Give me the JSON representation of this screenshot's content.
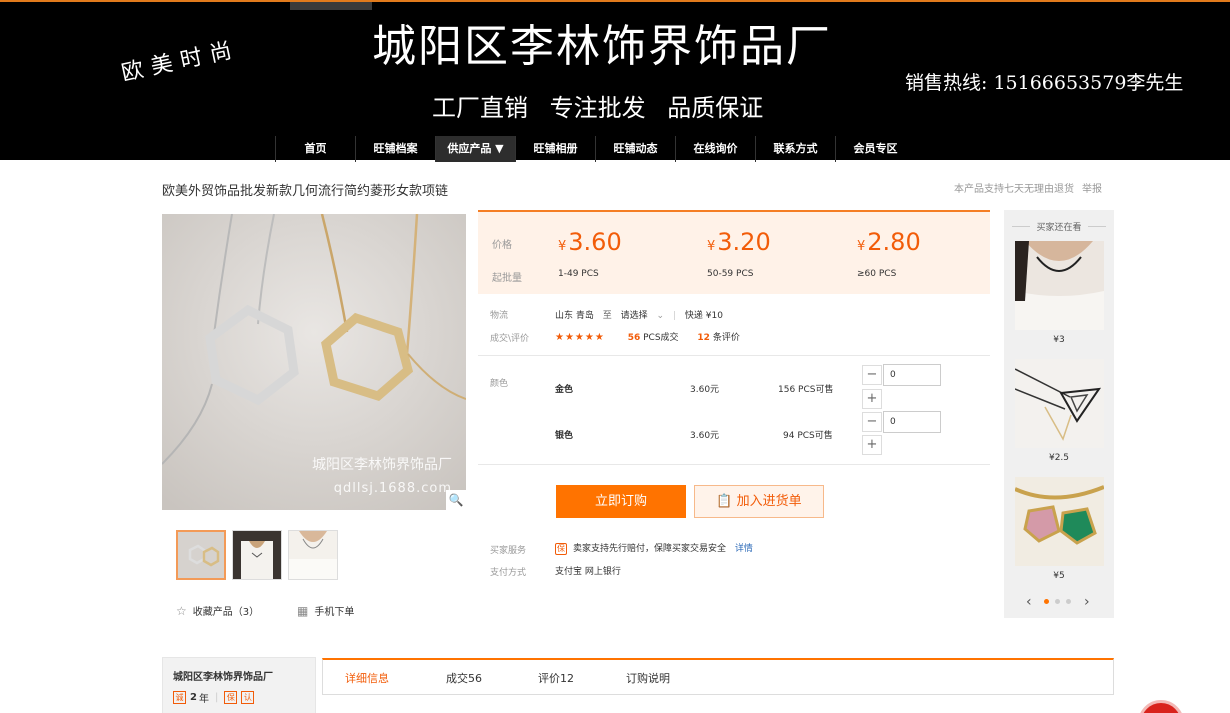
{
  "banner": {
    "slogan": "欧美时尚",
    "shop_name": "城阳区李林饰界饰品厂",
    "subline": "工厂直销  专注批发  品质保证",
    "hotline": "销售热线: 15166653579李先生"
  },
  "nav": {
    "items": [
      "首页",
      "旺铺档案",
      "供应产品 ▼",
      "旺铺相册",
      "旺铺动态",
      "在线询价",
      "联系方式",
      "会员专区"
    ],
    "active_index": 2
  },
  "product": {
    "title": "欧美外贸饰品批发新款几何流行简约菱形女款项链",
    "return_note": "本产品支持七天无理由退货",
    "report": "举报",
    "watermark_line1": "城阳区李林饰界饰品厂",
    "watermark_line2": "qdllsj.1688.com",
    "zoom_icon": "magnifier-icon",
    "favorite": "收藏产品（3）",
    "mobile_order": "手机下单"
  },
  "pricing": {
    "price_label": "价格",
    "moq_label": "起批量",
    "currency": "¥",
    "tiers": [
      {
        "price": "3.60",
        "range": "1-49 PCS"
      },
      {
        "price": "3.20",
        "range": "50-59 PCS"
      },
      {
        "price": "2.80",
        "range": "≥60 PCS"
      }
    ],
    "accent_color": "#f25c09"
  },
  "logistics": {
    "label": "物流",
    "from": "山东 青岛",
    "to_word": "至",
    "destination": "请选择",
    "shipping": "快递 ¥10"
  },
  "deals": {
    "label": "成交\\评价",
    "stars": "★★★★★",
    "sold_count": "56",
    "sold_suffix": "PCS成交",
    "review_count": "12",
    "review_suffix": "条评价"
  },
  "variants": {
    "label": "颜色",
    "items": [
      {
        "name": "金色",
        "price": "3.60元",
        "stock": "156 PCS可售",
        "qty": "0"
      },
      {
        "name": "银色",
        "price": "3.60元",
        "stock": "94 PCS可售",
        "qty": "0"
      }
    ],
    "minus": "−",
    "plus": "+"
  },
  "actions": {
    "buy_now": "立即订购",
    "add_to_list": "加入进货单"
  },
  "services": {
    "buyer_label": "买家服务",
    "buyer_text": "卖家支持先行赔付，保障买家交易安全",
    "details": "详情",
    "payment_label": "支付方式",
    "payment_methods": "支付宝   网上银行"
  },
  "sidebar": {
    "title": "买家还在看",
    "items": [
      {
        "price": "¥3"
      },
      {
        "price": "¥2.5"
      },
      {
        "price": "¥5"
      }
    ],
    "prev": "‹",
    "next": "›"
  },
  "company": {
    "name": "城阳区李林饰界饰品厂",
    "years": "2",
    "years_suffix": "年"
  },
  "tabs": {
    "items": [
      "详细信息",
      "成交56",
      "评价12",
      "订购说明"
    ],
    "active_index": 0
  }
}
